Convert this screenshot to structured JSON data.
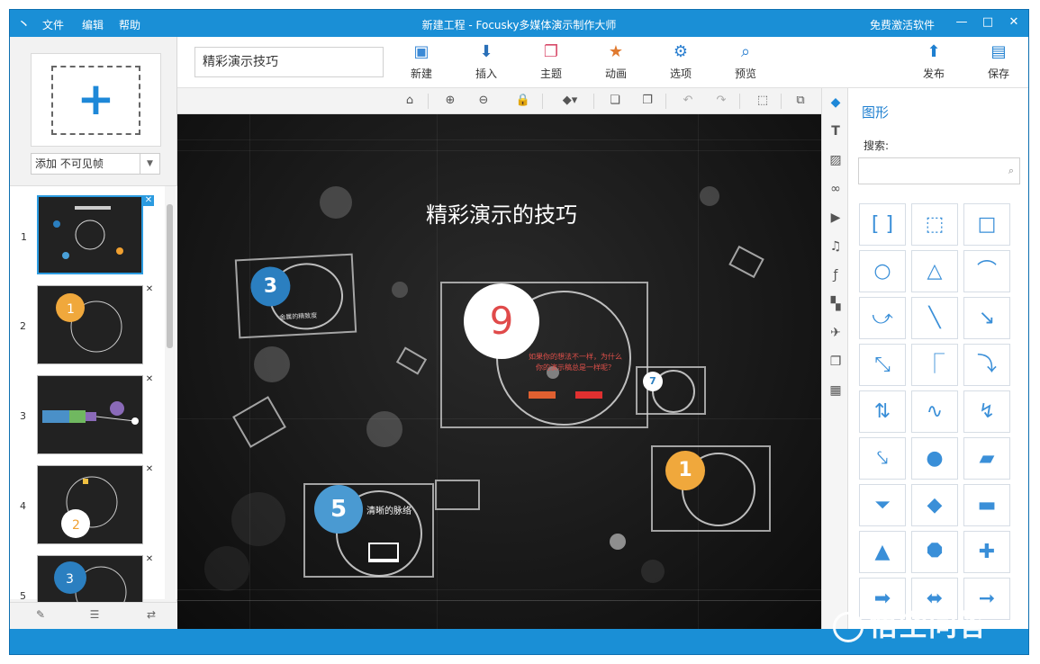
{
  "titlebar": {
    "menu": [
      "文件",
      "编辑",
      "帮助"
    ],
    "title": "新建工程 - Focusky多媒体演示制作大师",
    "activate": "免费激活软件",
    "minimize": "—",
    "maximize": "□",
    "close": "✕"
  },
  "left": {
    "add_select": "添加 不可见帧",
    "slides": [
      {
        "n": "1"
      },
      {
        "n": "2"
      },
      {
        "n": "3"
      },
      {
        "n": "4"
      },
      {
        "n": "5"
      }
    ]
  },
  "toolbar": {
    "title_value": "精彩演示技巧",
    "buttons": [
      "新建",
      "插入",
      "主题",
      "动画",
      "选项",
      "预览",
      "发布",
      "保存"
    ]
  },
  "canvas": {
    "main_title": "精彩演示的技巧",
    "badge_3": "3",
    "badge_9": "9",
    "badge_7": "7",
    "badge_1": "1",
    "badge_5": "5",
    "text_5": "清晰的脉络",
    "text_9": "如果你的想法不一样，为什么你的演示稿总是一样呢？",
    "text_3": "金属的精致度"
  },
  "shapes_panel": {
    "title": "图形",
    "search_label": "搜索:",
    "search_placeholder": ""
  },
  "watermark": "悟空问答"
}
